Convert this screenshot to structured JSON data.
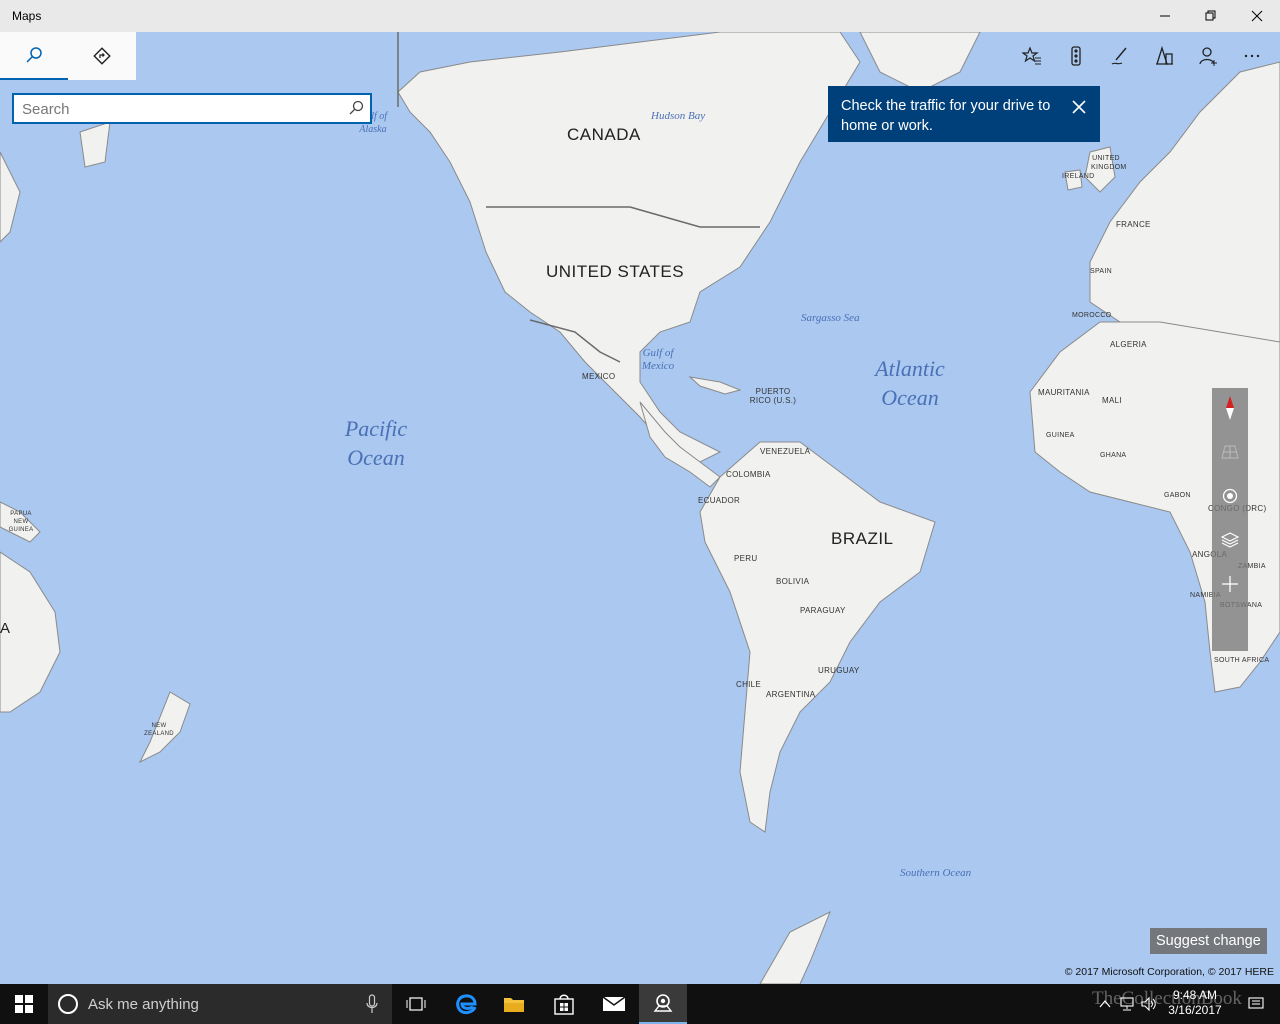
{
  "window": {
    "title": "Maps"
  },
  "search": {
    "placeholder": "Search"
  },
  "tip": {
    "text": "Check the traffic for your drive to home or work."
  },
  "map": {
    "labels": {
      "canada": "CANADA",
      "united_states": "UNITED STATES",
      "brazil": "BRAZIL",
      "mexico": "MEXICO",
      "puerto_rico": "PUERTO RICO (U.S.)",
      "venezuela": "VENEZUELA",
      "colombia": "COLOMBIA",
      "ecuador": "ECUADOR",
      "peru": "PERU",
      "bolivia": "BOLIVIA",
      "paraguay": "PARAGUAY",
      "uruguay": "URUGUAY",
      "chile": "CHILE",
      "argentina": "ARGENTINA",
      "united_kingdom": "UNITED KINGDOM",
      "ireland": "IRELAND",
      "france": "FRANCE",
      "spain": "SPAIN",
      "morocco": "MOROCCO",
      "algeria": "ALGERIA",
      "mauritania": "MAURITANIA",
      "mali": "MALI",
      "guinea": "GUINEA",
      "ghana": "GHANA",
      "gabon": "GABON",
      "congo_drc": "CONGO (DRC)",
      "angola": "ANGOLA",
      "zambia": "ZAMBIA",
      "namibia": "NAMIBIA",
      "botswana": "BOTSWANA",
      "south_africa": "SOUTH AFRICA",
      "papua": "PAPUA NEW GUINEA",
      "new_zealand": "NEW ZEALAND",
      "australia_partial": "A",
      "pacific_ocean": "Pacific Ocean",
      "atlantic_ocean": "Atlantic Ocean",
      "southern_ocean": "Southern Ocean",
      "hudson_bay": "Hudson Bay",
      "sargasso_sea": "Sargasso Sea",
      "gulf_mexico": "Gulf of Mexico",
      "gulf_alaska": "Gulf of Alaska"
    }
  },
  "suggest_change": "Suggest change",
  "copyright": "© 2017 Microsoft Corporation, © 2017 HERE",
  "taskbar": {
    "cortana_text": "Ask me anything",
    "time": "9:48 AM",
    "date": "3/16/2017",
    "watermark": "TheCollectionBook"
  }
}
